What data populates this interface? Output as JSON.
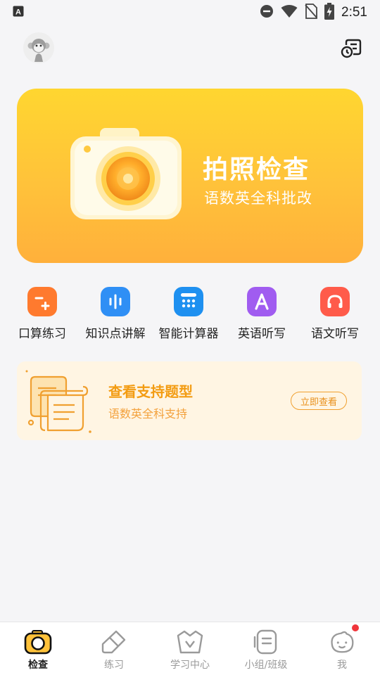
{
  "status_bar": {
    "time": "2:51",
    "icons": [
      "a-notification-icon",
      "dnd-icon",
      "wifi-icon",
      "no-sim-icon",
      "battery-charging-icon"
    ]
  },
  "header": {
    "avatar_icon": "monkey-avatar-icon",
    "right_icon": "history-icon"
  },
  "hero": {
    "title": "拍照检查",
    "subtitle": "语数英全科批改",
    "icon": "camera-icon"
  },
  "quick_actions": [
    {
      "label": "口算练习",
      "icon": "minus-plus-icon",
      "color": "#ff7a2e"
    },
    {
      "label": "知识点讲解",
      "icon": "audio-wave-icon",
      "color": "#2f8ff5"
    },
    {
      "label": "智能计算器",
      "icon": "calculator-icon",
      "color": "#1e90f0"
    },
    {
      "label": "英语听写",
      "icon": "letter-a-icon",
      "color": "#a05cf0"
    },
    {
      "label": "语文听写",
      "icon": "headphones-icon",
      "color": "#ff5b4a"
    }
  ],
  "support_card": {
    "title": "查看支持题型",
    "subtitle": "语数英全科支持",
    "button": "立即查看"
  },
  "bottom_nav": [
    {
      "label": "检查",
      "icon": "camera-icon",
      "active": true
    },
    {
      "label": "练习",
      "icon": "eraser-icon",
      "active": false
    },
    {
      "label": "学习中心",
      "icon": "basket-icon",
      "active": false
    },
    {
      "label": "小组/班级",
      "icon": "group-icon",
      "active": false
    },
    {
      "label": "我",
      "icon": "baby-face-icon",
      "active": false,
      "badge": true
    }
  ],
  "colors": {
    "accent": "#ffc23a",
    "support_text": "#f39c12",
    "badge": "#f0353b"
  }
}
